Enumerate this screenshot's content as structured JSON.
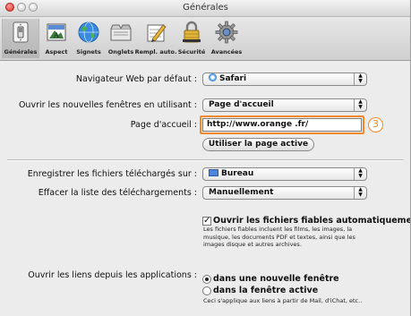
{
  "window": {
    "title": "Générales"
  },
  "toolbar": {
    "items": [
      {
        "label": "Générales",
        "icon": "light-switch-icon",
        "selected": true
      },
      {
        "label": "Aspect",
        "icon": "appearance-icon",
        "selected": false
      },
      {
        "label": "Signets",
        "icon": "globe-bookmarks-icon",
        "selected": false
      },
      {
        "label": "Onglets",
        "icon": "tabs-icon",
        "selected": false
      },
      {
        "label": "Rempl. auto.",
        "icon": "autofill-pencil-icon",
        "selected": false
      },
      {
        "label": "Sécurité",
        "icon": "lock-icon",
        "selected": false
      },
      {
        "label": "Avancées",
        "icon": "gear-icon",
        "selected": false
      }
    ]
  },
  "general": {
    "default_browser_label": "Navigateur Web par défaut :",
    "default_browser_value": "Safari",
    "new_windows_label": "Ouvrir les nouvelles fenêtres en utilisant :",
    "new_windows_value": "Page d'accueil",
    "homepage_label": "Page d'accueil :",
    "homepage_value": "http://www.orange .fr/",
    "callout_number": "3",
    "use_current_page_label": "Utiliser la page active",
    "downloads_folder_label": "Enregistrer les fichiers téléchargés sur :",
    "downloads_folder_value": "Bureau",
    "clear_downloads_label": "Effacer la liste des téléchargements :",
    "clear_downloads_value": "Manuellement",
    "open_safe_files_label": "Ouvrir les fichiers fiables automatiquement",
    "open_safe_files_checked": true,
    "safe_files_note_lines": [
      "Les fichiers fiables incluent les films, les images, la",
      "musique, les documents PDF et textes, ainsi que les",
      "images disque et autres archives."
    ],
    "open_links_label": "Ouvrir les liens depuis les applications :",
    "open_links_options": [
      {
        "label": "dans une nouvelle fenêtre",
        "selected": true
      },
      {
        "label": "dans la fenêtre active",
        "selected": false
      }
    ],
    "open_links_note": "Ceci s'applique aux liens à partir de Mail, d'iChat, etc.."
  },
  "colors": {
    "callout_accent": "#f08a2a"
  }
}
